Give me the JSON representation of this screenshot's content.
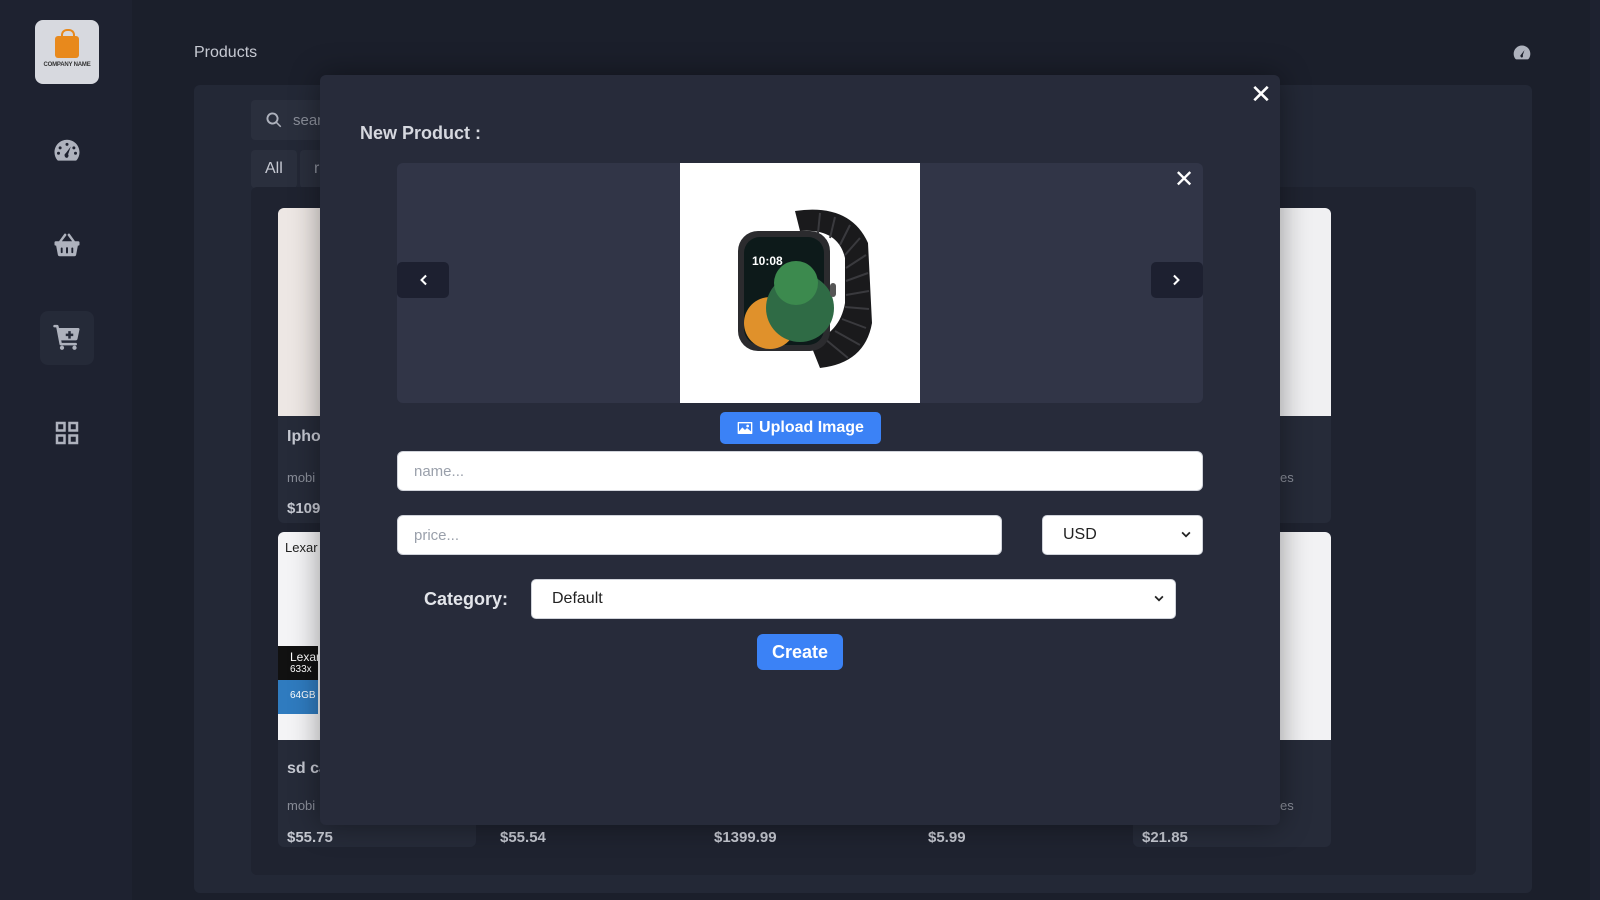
{
  "sidebar": {
    "logo_text": "COMPANY NAME",
    "items": [
      {
        "name": "dashboard",
        "icon": "gauge-icon"
      },
      {
        "name": "orders",
        "icon": "basket-icon"
      },
      {
        "name": "products",
        "icon": "cart-plus-icon",
        "active": true
      },
      {
        "name": "categories",
        "icon": "grid-icon"
      }
    ]
  },
  "header": {
    "title": "Products",
    "icon": "gauge-icon"
  },
  "background": {
    "search_placeholder": "sear",
    "filter_all": "All",
    "filter_second": "r",
    "cards_top": [
      {
        "title": "Ipho",
        "category": "mobi",
        "price": "$109"
      },
      {
        "category": "es"
      }
    ],
    "cards_bottom": [
      {
        "title": "sd ca",
        "category": "mobi",
        "price": "$55.75"
      },
      {
        "price": "$55.54"
      },
      {
        "price": "$1399.99"
      },
      {
        "price": "$5.99"
      },
      {
        "category": "es",
        "price": "$21.85"
      }
    ],
    "lexar_label": "Lexar",
    "lexar_card_text": "Lexar",
    "lexar_speed": "633x",
    "lexar_capacity": "64GB"
  },
  "modal": {
    "title": "New Product :",
    "upload_label": "Upload Image",
    "name_placeholder": "name...",
    "price_placeholder": "price...",
    "currency": "USD",
    "category_label": "Category:",
    "category_value": "Default",
    "create_label": "Create",
    "watch_time": "10:08"
  },
  "colors": {
    "accent": "#3b82f6",
    "background": "#1b1f2b",
    "modal": "#272b3a"
  }
}
